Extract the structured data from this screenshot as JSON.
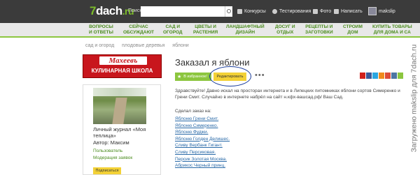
{
  "header": {
    "logo_num": "7",
    "logo_text": "dach",
    "logo_tld": ".ru",
    "search_label": "Поиск:",
    "search_value": "",
    "nav": [
      "Конкурсы",
      "Тестирования",
      "Фото",
      "Написать"
    ],
    "username": "makslip"
  },
  "categories": [
    [
      "ВОПРОСЫ",
      "И ОТВЕТЫ"
    ],
    [
      "СЕЙЧАС",
      "ОБСУЖДАЮТ"
    ],
    [
      "САД И",
      "ОГОРОД"
    ],
    [
      "ЦВЕТЫ И",
      "РАСТЕНИЯ"
    ],
    [
      "ЛАНДШАФТНЫЙ",
      "ДИЗАЙН"
    ],
    [
      "ДОСУГ И",
      "ОТДЫХ"
    ],
    [
      "РЕЦЕПТЫ И",
      "ЗАГОТОВКИ"
    ],
    [
      "СТРОИМ",
      "ДОМ"
    ],
    [
      "КУПИТЬ ТОВАРЫ",
      "ДЛЯ ДОМА И СА"
    ]
  ],
  "breadcrumb": [
    "сад и огород",
    "плодовые деревья",
    "яблони"
  ],
  "banner": {
    "brand": "Махеевъ",
    "subtitle": "КУЛИНАРНАЯ ШКОЛА"
  },
  "journal": {
    "title": "Личный журнал «Моя теплица»",
    "author": "Автор: Максим",
    "role": "Пользователь",
    "moderation": "Модерация заявок",
    "subscribe_label": "Подписаться"
  },
  "post": {
    "title": "Заказал я яблони",
    "fav_label": "В избранное!",
    "edit_label": "Редактировать",
    "more_label": "•••",
    "text": "Здравствуйте! Давно искал на просторах интернета и в Липецких питомниках яблони сортов Симеренко и Грени Смит. Случайно в интернете набрёл на сайт н.кфх-вашсад.рф/ Ваш Сад.",
    "list_intro": "Сделал заказ на:",
    "items": [
      "Яблоню Грени Смит.",
      "Яблоню Симеренко.",
      "Яблоню Фуджи.",
      "Яблоню Голден Делишес.",
      "Сливу Вербанк Гигант.",
      "Сливу Персиковая.",
      "Персик Золотая Москва.",
      "Абрикос Черный принц."
    ]
  },
  "share_colors": [
    "#d0201a",
    "#3a5998",
    "#2aa6e0",
    "#f08a1c",
    "#dd4b39",
    "#4c75a3",
    "#8cc63f"
  ],
  "watermark": "Загружено makslip для 7dach.ru"
}
